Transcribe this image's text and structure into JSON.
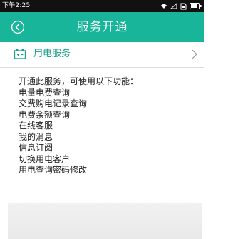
{
  "status_bar": {
    "time": "下午2:25",
    "icons": [
      "wifi-icon",
      "signal-icon",
      "sim-icon",
      "battery-icon"
    ]
  },
  "app_bar": {
    "title": "服务开通",
    "back_icon": "back-circle-icon",
    "background": "#19b59a"
  },
  "service_row": {
    "icon": "battery-service-icon",
    "label": "用电服务",
    "label_color": "#19a08a",
    "chevron_icon": "chevron-right-icon"
  },
  "description": {
    "intro": "开通此服务，可使用以下功能：",
    "features": [
      "电量电费查询",
      "交费购电记录查询",
      "电费余额查询",
      "在线客服",
      "我的消息",
      "信息订阅",
      "切换用电客户",
      "用电查询密码修改"
    ]
  }
}
